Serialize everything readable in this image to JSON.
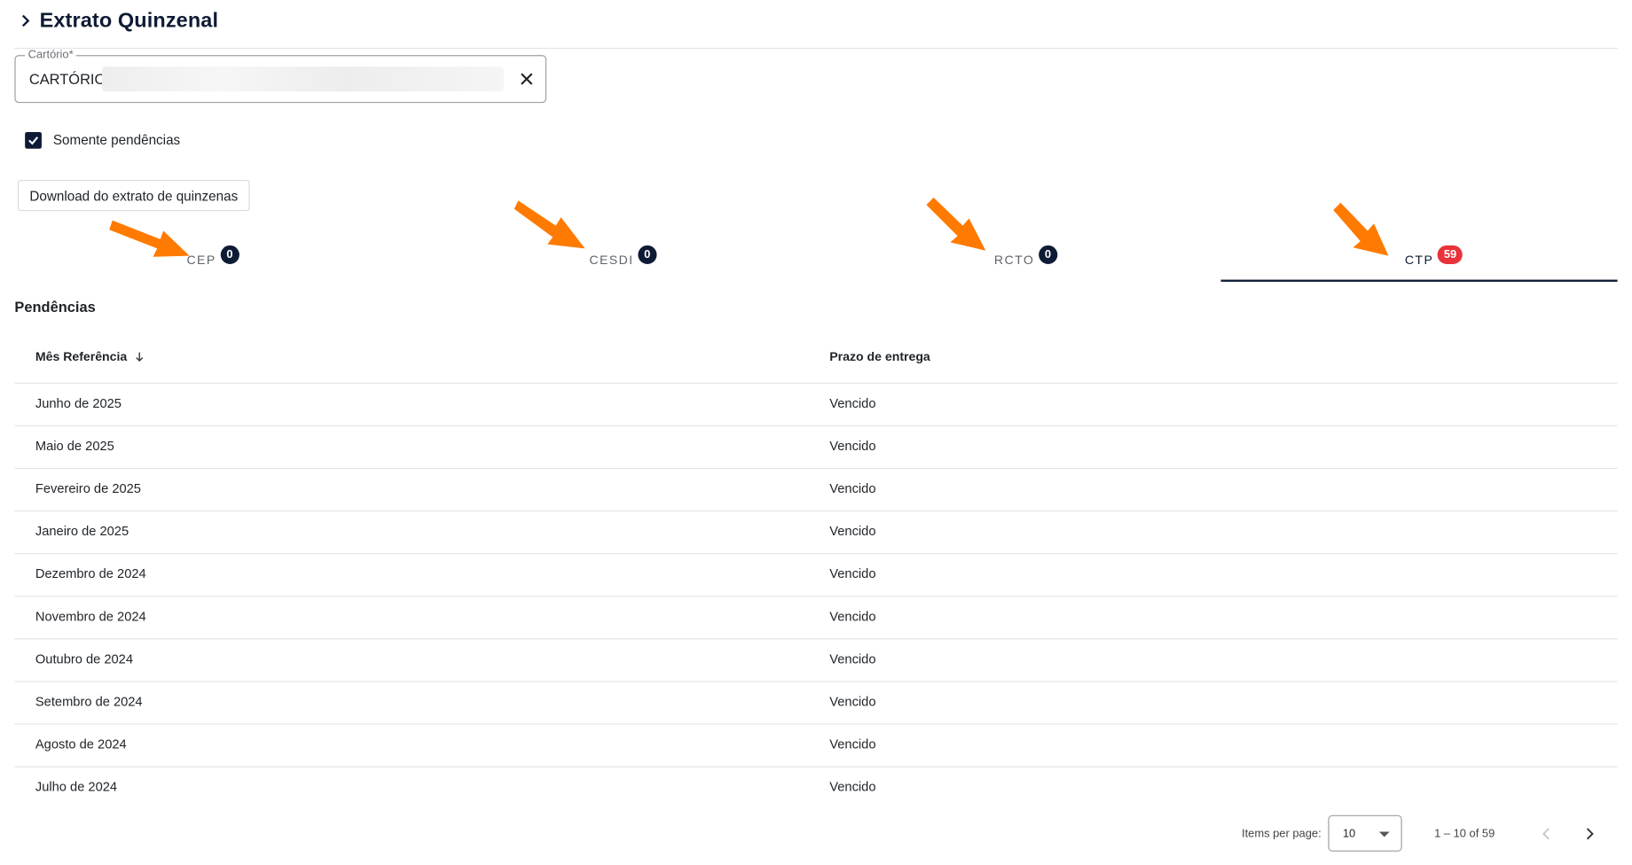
{
  "header": {
    "title": "Extrato Quinzenal"
  },
  "filter": {
    "label": "Cartório*",
    "value": "CARTÓRIO",
    "only_pending_label": "Somente pendências",
    "only_pending_checked": true
  },
  "download_button": "Download do extrato de quinzenas",
  "tabs": [
    {
      "label": "CEP",
      "count": "0"
    },
    {
      "label": "CESDI",
      "count": "0"
    },
    {
      "label": "RCTO",
      "count": "0"
    },
    {
      "label": "CTP",
      "count": "59"
    }
  ],
  "active_tab": "CTP",
  "section_title": "Pendências",
  "table": {
    "columns": [
      "Mês Referência",
      "Prazo de entrega"
    ],
    "rows": [
      {
        "month": "Junho de 2025",
        "deadline": "Vencido"
      },
      {
        "month": "Maio de 2025",
        "deadline": "Vencido"
      },
      {
        "month": "Fevereiro de 2025",
        "deadline": "Vencido"
      },
      {
        "month": "Janeiro de 2025",
        "deadline": "Vencido"
      },
      {
        "month": "Dezembro de 2024",
        "deadline": "Vencido"
      },
      {
        "month": "Novembro de 2024",
        "deadline": "Vencido"
      },
      {
        "month": "Outubro de 2024",
        "deadline": "Vencido"
      },
      {
        "month": "Setembro de 2024",
        "deadline": "Vencido"
      },
      {
        "month": "Agosto de 2024",
        "deadline": "Vencido"
      },
      {
        "month": "Julho de 2024",
        "deadline": "Vencido"
      }
    ]
  },
  "paginator": {
    "items_per_page_label": "Items per page:",
    "items_per_page": "10",
    "range": "1 – 10 of 59"
  },
  "colors": {
    "primary": "#0e1b35",
    "badge_alert": "#e8333a",
    "arrow": "#ff7a00"
  }
}
